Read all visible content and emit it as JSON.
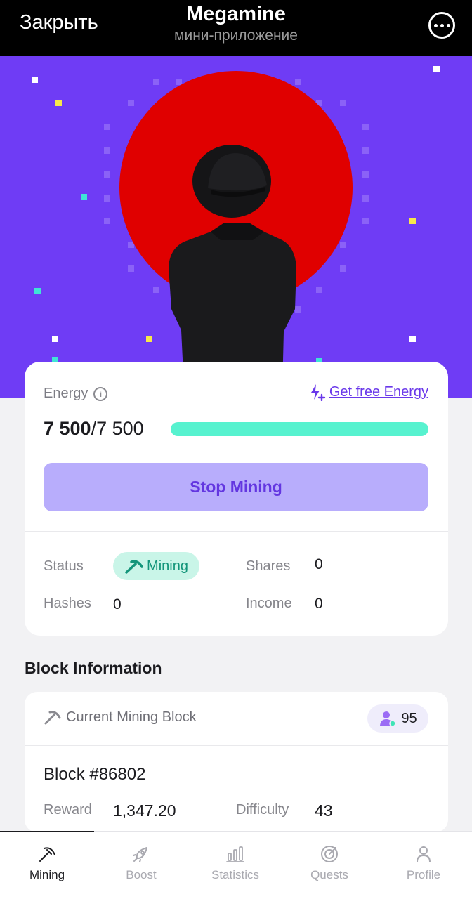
{
  "topbar": {
    "close_label": "Закрыть",
    "title": "Megamine",
    "subtitle": "мини-приложение",
    "more_icon": "more-dots-icon"
  },
  "hero": {
    "image": "red-sun-figure-in-hat-illustration",
    "background_color": "#6f3cf5",
    "sun_color": "#e00000"
  },
  "energy": {
    "label": "Energy",
    "get_free_label": "Get free Energy",
    "current": "7 500",
    "max_display": "/7 500",
    "fill_fraction": 1.0,
    "bar_color": "#57f2cf"
  },
  "stop_button_label": "Stop Mining",
  "stats": {
    "status_label": "Status",
    "status_value": "Mining",
    "shares_label": "Shares",
    "shares_value": "0",
    "hashes_label": "Hashes",
    "hashes_value": "0",
    "income_label": "Income",
    "income_value": "0"
  },
  "block_info": {
    "section_title": "Block Information",
    "current_block_label": "Current Mining Block",
    "miners_count": "95",
    "block_number": "Block #86802",
    "reward_label": "Reward",
    "reward_value": "1,347.20",
    "difficulty_label": "Difficulty",
    "difficulty_value": "43"
  },
  "nav": {
    "items": [
      {
        "label": "Mining",
        "icon": "pickaxe-icon",
        "active": true
      },
      {
        "label": "Boost",
        "icon": "rocket-icon",
        "active": false
      },
      {
        "label": "Statistics",
        "icon": "bar-chart-icon",
        "active": false
      },
      {
        "label": "Quests",
        "icon": "target-icon",
        "active": false
      },
      {
        "label": "Profile",
        "icon": "user-icon",
        "active": false
      }
    ]
  },
  "colors": {
    "accent": "#6a38ea",
    "button_bg": "#b8adfc",
    "mining_pill_bg": "#c9f5e8",
    "mining_pill_text": "#13957a"
  }
}
